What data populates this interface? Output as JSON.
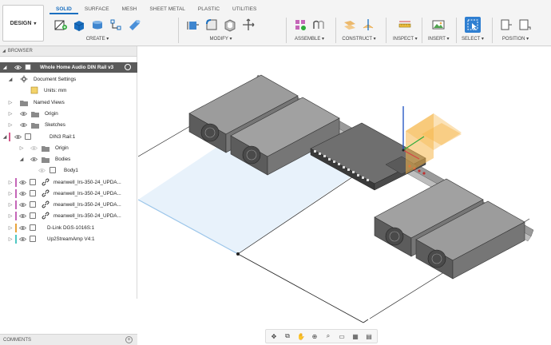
{
  "toolbar": {
    "design_label": "DESIGN",
    "tabs": [
      "SOLID",
      "SURFACE",
      "MESH",
      "SHEET METAL",
      "PLASTIC",
      "UTILITIES"
    ],
    "groups": {
      "create": "CREATE ▾",
      "modify": "MODIFY ▾",
      "assemble": "ASSEMBLE ▾",
      "construct": "CONSTRUCT ▾",
      "inspect": "INSPECT ▾",
      "insert": "INSERT ▾",
      "select": "SELECT ▾",
      "position": "POSITION ▾"
    },
    "accent": "#1a6fc0"
  },
  "browser": {
    "header": "BROWSER",
    "root": "Whole Home Audio DIN Rail v3",
    "document_settings": "Document Settings",
    "units": "Units: mm",
    "named_views": "Named Views",
    "origin": "Origin",
    "sketches": "Sketches",
    "din_rail": "DIN3 Rail:1",
    "din_origin": "Origin",
    "bodies": "Bodies",
    "body1": "Body1",
    "components": [
      {
        "label": "meanwell_lrs-350-24_UPDA...",
        "color": "#c566b8"
      },
      {
        "label": "meanwell_lrs-350-24_UPDA...",
        "color": "#c566b8"
      },
      {
        "label": "meanwell_lrs-350-24_UPDA...",
        "color": "#c566b8"
      },
      {
        "label": "meanwell_lrs-350-24_UPDA...",
        "color": "#c566b8"
      },
      {
        "label": "D-Link DGS-1016S:1",
        "color": "#e8a33c"
      },
      {
        "label": "Up2StreamAmp V4:1",
        "color": "#4fc7c2"
      }
    ]
  },
  "comments": {
    "label": "COMMENTS"
  }
}
